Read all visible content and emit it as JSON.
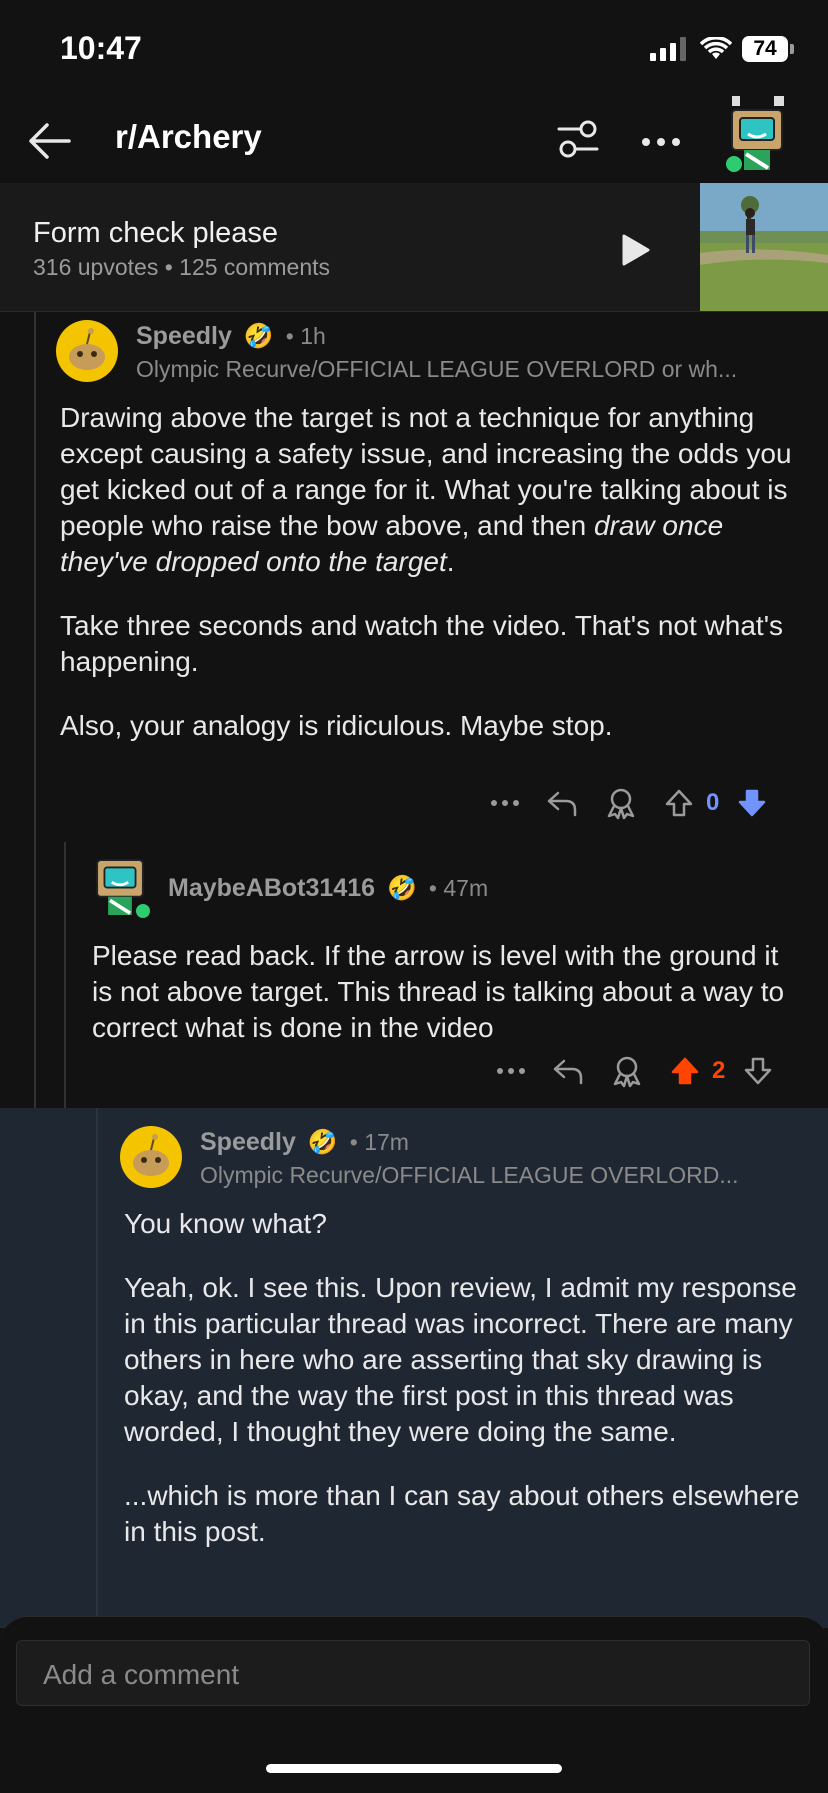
{
  "status": {
    "time": "10:47",
    "battery": "74"
  },
  "header": {
    "subreddit": "r/Archery"
  },
  "post": {
    "title": "Form check please",
    "meta": "316 upvotes • 125 comments"
  },
  "comments": [
    {
      "username": "Speedly",
      "time": "• 1h",
      "flair": "Olympic Recurve/OFFICIAL LEAGUE OVERLORD or wh...",
      "paragraphs": [
        "Drawing above the target is not a technique for anything except causing a safety issue, and increasing the odds you get kicked out of a range for it. What you're talking about is people who raise the bow above, and then ",
        "Take three seconds and watch the video. That's not what's happening.",
        "Also, your analogy is ridiculous. Maybe stop."
      ],
      "italic": "draw once they've dropped onto the target",
      "italic_tail": ".",
      "votes": "0"
    },
    {
      "username": "MaybeABot31416",
      "time": "• 47m",
      "paragraphs": [
        "Please read back. If the arrow is level with the ground it is not above target. This thread is talking about a way to correct what is done in the video"
      ],
      "votes": "2"
    },
    {
      "username": "Speedly",
      "time": "• 17m",
      "flair": "Olympic Recurve/OFFICIAL LEAGUE OVERLORD...",
      "paragraphs": [
        "You know what?",
        "Yeah, ok. I see this. Upon review, I admit my response in this particular thread was incorrect. There are many others in here who are asserting that sky drawing is okay, and the way the first post in this thread was worded, I thought they were doing the same.",
        "...which is more than I can say about others elsewhere in this post."
      ]
    }
  ],
  "composer": {
    "placeholder": "Add a comment"
  },
  "colors": {
    "upvote": "#ff4500",
    "downvote": "#7193ff",
    "highlight_bg": "#1f2733"
  }
}
